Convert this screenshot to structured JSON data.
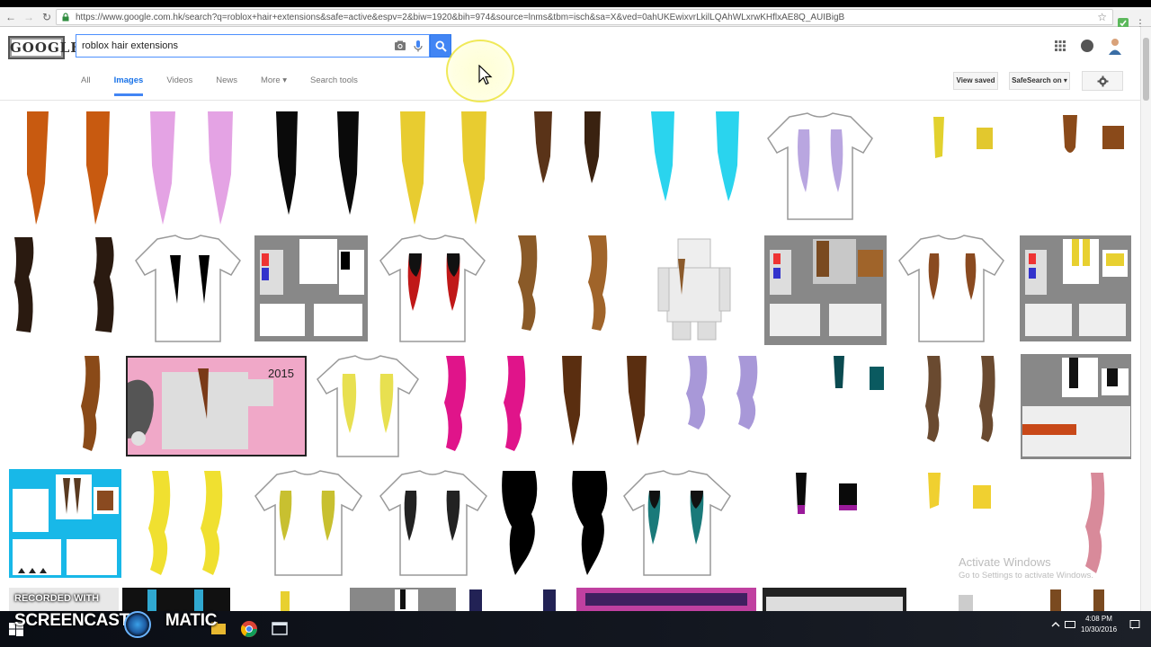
{
  "browser": {
    "url": "https://www.google.com.hk/search?q=roblox+hair+extensions&safe=active&espv=2&biw=1920&bih=974&source=lnms&tbm=isch&sa=X&ved=0ahUKEwixvrLkilLQAhWLxrwKHflxAE8Q_AUIBigB",
    "back_icon": "back-arrow-icon",
    "forward_icon": "forward-arrow-icon",
    "reload_icon": "reload-icon"
  },
  "google": {
    "logo_text": "GOOGLE",
    "search_query": "roblox hair extensions",
    "tabs": [
      {
        "label": "All",
        "active": false
      },
      {
        "label": "Images",
        "active": true
      },
      {
        "label": "Videos",
        "active": false
      },
      {
        "label": "News",
        "active": false
      },
      {
        "label": "More ▾",
        "active": false
      },
      {
        "label": "Search tools",
        "active": false
      }
    ],
    "view_saved": "View saved",
    "safesearch": "SafeSearch on ▾"
  },
  "watermark": {
    "line1": "Activate Windows",
    "line2": "Go to Settings to activate Windows."
  },
  "recording": {
    "line1": "RECORDED WITH",
    "line2": "SCREENCAST",
    "line2b": "MATIC"
  },
  "taskbar": {
    "time": "4:08 PM",
    "date": "10/30/2016"
  },
  "colors": {
    "accent_blue": "#4285f4",
    "active_tab": "#1a73e8"
  }
}
